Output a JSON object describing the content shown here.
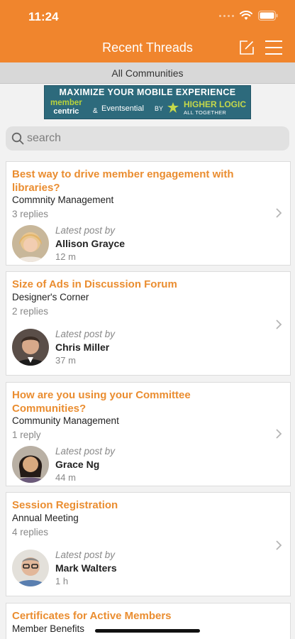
{
  "status": {
    "time": "11:24"
  },
  "nav": {
    "title": "Recent Threads",
    "compose_icon": "compose-icon",
    "menu_icon": "hamburger-menu-icon"
  },
  "community_filter": {
    "label": "All Communities"
  },
  "banner": {
    "headline": "MAXIMIZE YOUR MOBILE EXPERIENCE",
    "member": "member",
    "centric": "centric",
    "amp": "&",
    "eventsential": "Eventsential",
    "by": "BY",
    "higher_logic": "HIGHER LOGIC",
    "tagline": "ALL TOGETHER",
    "colors": {
      "background": "#2d6a7c",
      "accent": "#b8d23c"
    }
  },
  "search": {
    "placeholder": "search"
  },
  "colors": {
    "brand": "#f0852d",
    "thread_title": "#ea8d30"
  },
  "latest_post_label": "Latest post by",
  "threads": [
    {
      "title": "Best way to drive member engagement with libraries?",
      "community": "Commnity Management",
      "replies": "3 replies",
      "author": "Allison Grayce",
      "time": "12 m"
    },
    {
      "title": "Size of Ads in Discussion Forum",
      "community": "Designer's Corner",
      "replies": "2 replies",
      "author": "Chris Miller",
      "time": "37 m"
    },
    {
      "title": "How are you using your Committee Communities?",
      "community": "Community Management",
      "replies": "1 reply",
      "author": "Grace Ng",
      "time": "44 m"
    },
    {
      "title": "Session Registration",
      "community": "Annual Meeting",
      "replies": "4 replies",
      "author": "Mark Walters",
      "time": "1 h"
    },
    {
      "title": "Certificates for Active Members",
      "community": "Member Benefits"
    }
  ]
}
